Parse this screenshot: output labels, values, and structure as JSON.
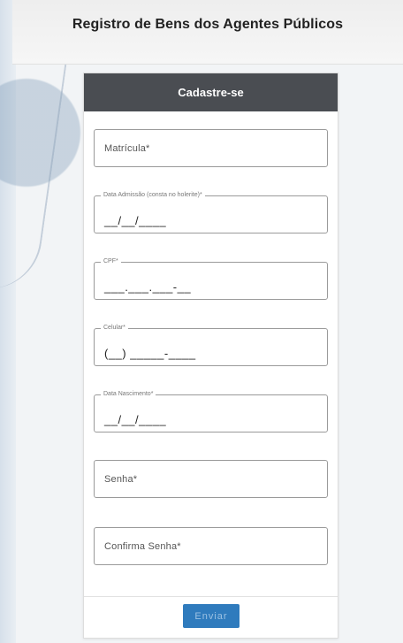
{
  "header": {
    "title": "Registro de Bens dos Agentes Públicos"
  },
  "form": {
    "title": "Cadastre-se",
    "fields": [
      {
        "placeholder": "Matrícula*"
      },
      {
        "legend": "Data Admissão (consta no holerite)*",
        "mask": "__/__/____"
      },
      {
        "legend": "CPF*",
        "mask": "___.___.___-__"
      },
      {
        "legend": "Celular*",
        "mask": "(__) _____-____"
      },
      {
        "legend": "Data Nascimento*",
        "mask": "__/__/____"
      },
      {
        "placeholder": "Senha*"
      },
      {
        "placeholder": "Confirma Senha*"
      }
    ],
    "submit_label": "Enviar"
  },
  "colors": {
    "header_bg": "#4a4d52",
    "button_bg": "#2f7bbd"
  }
}
